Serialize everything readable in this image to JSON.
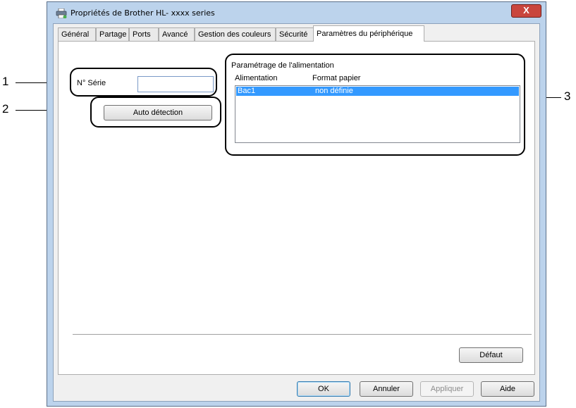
{
  "window": {
    "title": "Propriétés de Brother HL- xxxx  series",
    "close_label": "X"
  },
  "tabs": [
    {
      "label": "Général"
    },
    {
      "label": "Partage"
    },
    {
      "label": "Ports"
    },
    {
      "label": "Avancé"
    },
    {
      "label": "Gestion des couleurs"
    },
    {
      "label": "Sécurité"
    },
    {
      "label": "Paramètres du périphérique",
      "active": true
    }
  ],
  "serial": {
    "label": "N° Série",
    "value": ""
  },
  "auto_detect_label": "Auto détection",
  "paper_source": {
    "group_label": "Paramétrage de l'alimentation",
    "columns": [
      "Alimentation",
      "Format papier"
    ],
    "rows": [
      {
        "source": "Bac1",
        "format": "non définie",
        "selected": true
      }
    ]
  },
  "default_button": "Défaut",
  "footer": {
    "ok": "OK",
    "cancel": "Annuler",
    "apply": "Appliquer",
    "help": "Aide"
  },
  "callouts": [
    "1",
    "2",
    "3"
  ],
  "colors": {
    "selection": "#3399ff",
    "close_button": "#c9463d",
    "window_frame": "#bcd3ec"
  }
}
